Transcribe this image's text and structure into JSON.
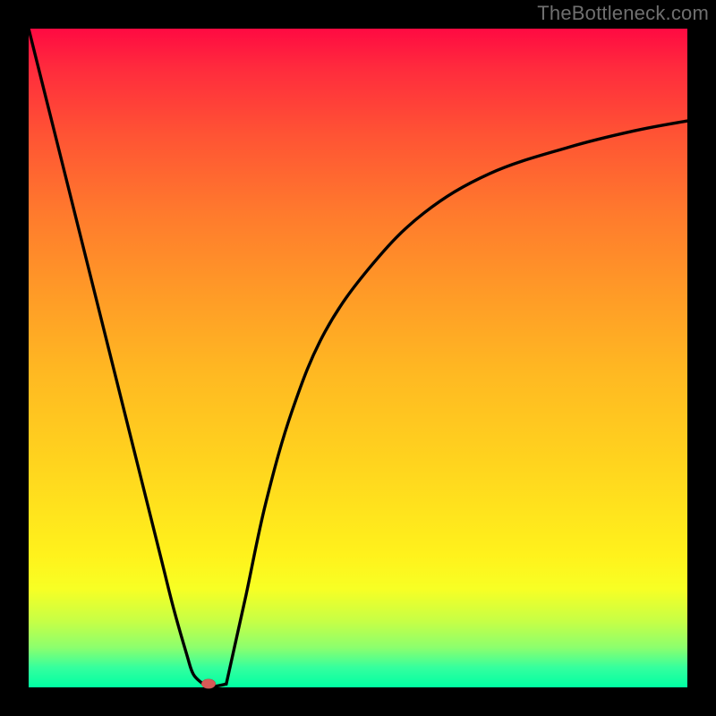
{
  "source_label": "TheBottleneck.com",
  "chart_data": {
    "type": "line",
    "title": "",
    "xlabel": "",
    "ylabel": "",
    "xlim": [
      0,
      100
    ],
    "ylim": [
      0,
      100
    ],
    "series": [
      {
        "name": "left-branch",
        "x": [
          0,
          4,
          8,
          12,
          16,
          20,
          22,
          24,
          25,
          26.5
        ],
        "y": [
          100,
          84,
          68,
          52,
          36,
          20,
          12,
          5,
          2,
          0.5
        ]
      },
      {
        "name": "right-branch",
        "x": [
          30,
          31,
          33,
          36,
          40,
          45,
          52,
          60,
          70,
          82,
          92,
          100
        ],
        "y": [
          0.5,
          5,
          14,
          28,
          42,
          54,
          64,
          72,
          78,
          82,
          84.5,
          86
        ]
      },
      {
        "name": "bottom-segment",
        "x": [
          26.5,
          27.5,
          28.5,
          30
        ],
        "y": [
          0.5,
          0.2,
          0.2,
          0.5
        ]
      }
    ],
    "marker": {
      "x": 27.3,
      "y": 0.6,
      "color": "#d85a57"
    },
    "background_gradient": {
      "type": "vertical",
      "stops": [
        {
          "pct": 0,
          "color": "#ff0a42"
        },
        {
          "pct": 16,
          "color": "#ff5334"
        },
        {
          "pct": 40,
          "color": "#ff9a27"
        },
        {
          "pct": 66,
          "color": "#ffd41e"
        },
        {
          "pct": 85,
          "color": "#f8ff24"
        },
        {
          "pct": 94,
          "color": "#8bff6e"
        },
        {
          "pct": 100,
          "color": "#00ffa3"
        }
      ]
    }
  }
}
